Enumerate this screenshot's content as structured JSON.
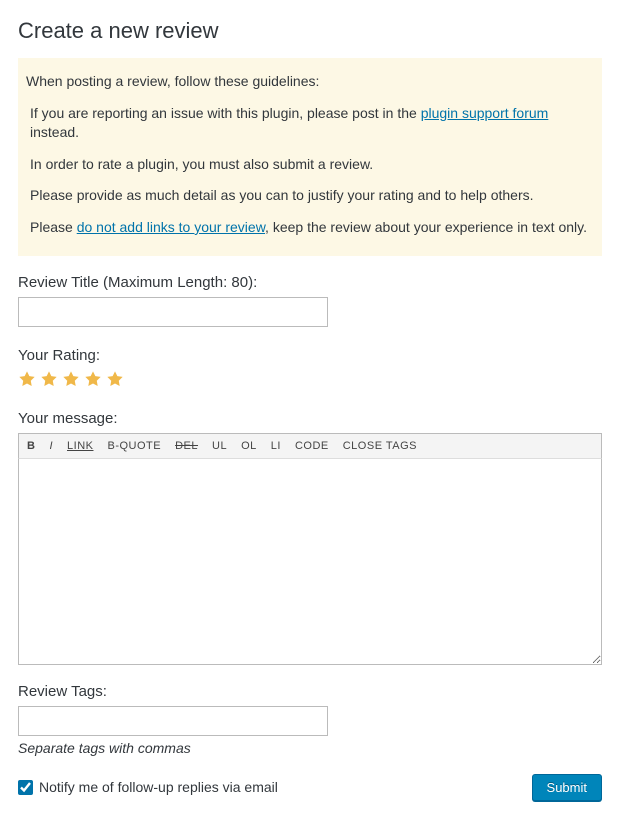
{
  "page": {
    "title": "Create a new review"
  },
  "guidelines": {
    "intro": "When posting a review, follow these guidelines:",
    "issue_pre": "If you are reporting an issue with this plugin, please post in the ",
    "issue_link": "plugin support forum",
    "issue_post": " instead.",
    "rate_line": "In order to rate a plugin, you must also submit a review.",
    "detail_line": "Please provide as much detail as you can to justify your rating and to help others.",
    "links_pre": "Please ",
    "links_link": "do not add links to your review",
    "links_post": ", keep the review about your experience in text only."
  },
  "labels": {
    "title": "Review Title (Maximum Length: 80):",
    "rating": "Your Rating:",
    "message": "Your message:",
    "tags": "Review Tags:",
    "tags_hint": "Separate tags with commas",
    "notify": "Notify me of follow-up replies via email"
  },
  "rating": {
    "value": 5,
    "max": 5
  },
  "toolbar": {
    "b": "B",
    "i": "I",
    "link": "LINK",
    "bquote": "B-QUOTE",
    "del": "DEL",
    "ul": "UL",
    "ol": "OL",
    "li": "LI",
    "code": "CODE",
    "close_tags": "CLOSE TAGS"
  },
  "fields": {
    "title_value": "",
    "message_value": "",
    "tags_value": "",
    "notify_checked": true
  },
  "actions": {
    "submit": "Submit"
  }
}
